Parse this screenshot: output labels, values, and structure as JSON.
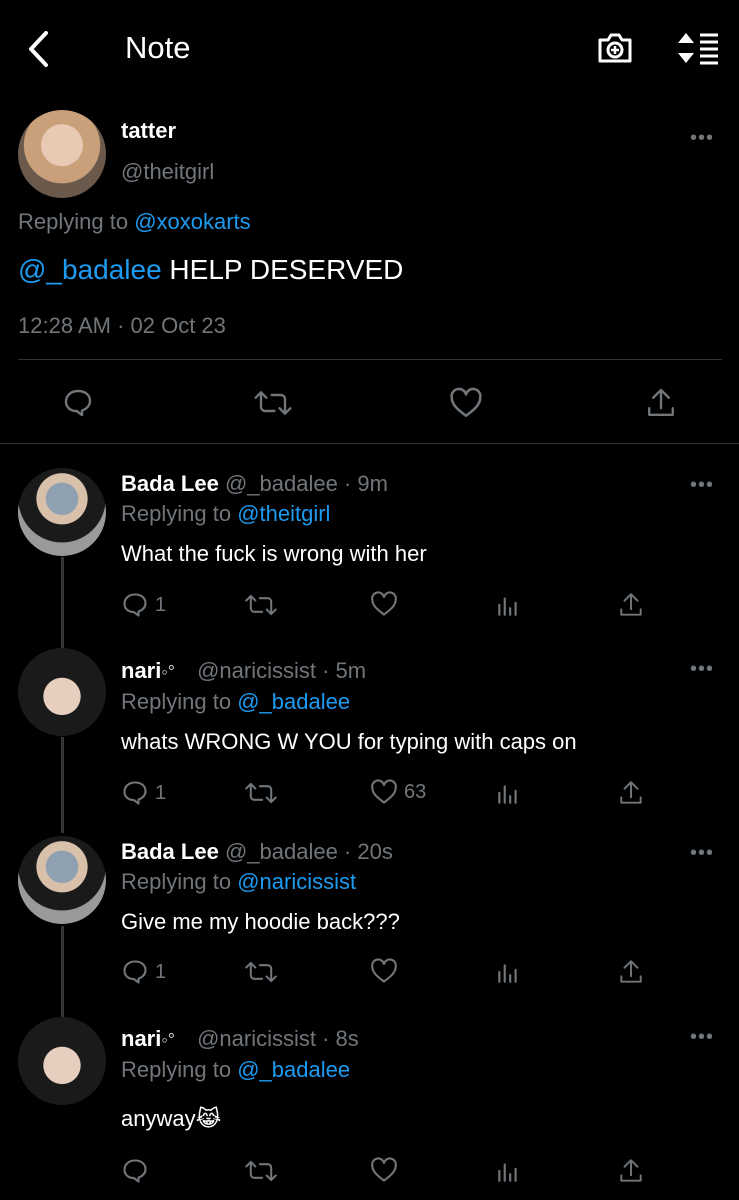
{
  "header": {
    "title": "Note",
    "back_icon": "chevron-left-icon",
    "camera_icon": "camera-plus-icon",
    "sort_icon": "sort-list-icon"
  },
  "main_tweet": {
    "name": "tatter",
    "handle": "@theitgirl",
    "replying_prefix": "Replying to ",
    "replying_to": "@xoxokarts",
    "mention": "@_badalee",
    "text": " HELP DESERVED",
    "timestamp": "12:28 AM · 02 Oct 23"
  },
  "replies": [
    {
      "name": "Bada Lee",
      "handle": "@_badalee · 9m",
      "replying_prefix": "Replying to ",
      "replying_to": "@theitgirl",
      "text": "What the fuck is wrong with her",
      "reply_count": "1",
      "like_count": ""
    },
    {
      "name": "nari",
      "name_badge": "◦°",
      "handle": "@naricissist · 5m",
      "replying_prefix": "Replying to ",
      "replying_to": "@_badalee",
      "text": "whats WRONG W YOU for typing with caps on",
      "reply_count": "1",
      "like_count": "63"
    },
    {
      "name": "Bada Lee",
      "handle": "@_badalee · 20s",
      "replying_prefix": "Replying to ",
      "replying_to": "@naricissist",
      "text": "Give me my hoodie back???",
      "reply_count": "1",
      "like_count": ""
    },
    {
      "name": "nari",
      "name_badge": "◦°",
      "handle": "@naricissist · 8s",
      "replying_prefix": "Replying to ",
      "replying_to": "@_badalee",
      "text": "anyway😹",
      "reply_count": "",
      "like_count": ""
    }
  ],
  "colors": {
    "accent": "#1d9bf0",
    "muted": "#71767b",
    "background": "#000000"
  }
}
